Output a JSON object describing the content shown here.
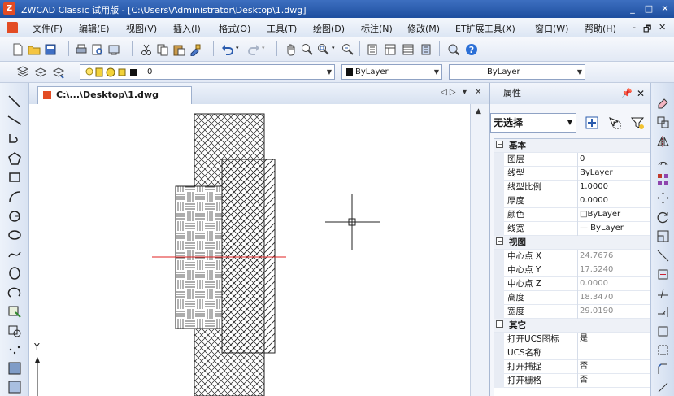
{
  "window": {
    "title": "ZWCAD Classic 试用版 - [C:\\Users\\Administrator\\Desktop\\1.dwg]",
    "controls": [
      "_",
      "□",
      "✕"
    ]
  },
  "menu": {
    "items": [
      "文件(F)",
      "编辑(E)",
      "视图(V)",
      "插入(I)",
      "格式(O)",
      "工具(T)",
      "绘图(D)",
      "标注(N)",
      "修改(M)",
      "ET扩展工具(X)",
      "窗口(W)",
      "帮助(H)"
    ],
    "mdi_controls": [
      "-",
      "🗗",
      "✕"
    ]
  },
  "toolbar": {
    "layer_value": "0",
    "color_value": "ByLayer",
    "linetype_value": "ByLayer"
  },
  "document": {
    "tab_label": "C:\\...\\Desktop\\1.dwg",
    "tab_controls": [
      "◁ ▷",
      "▾",
      "✕"
    ]
  },
  "canvas": {
    "ucs_label": "Y"
  },
  "properties": {
    "title": "属性",
    "pin": "📌",
    "close": "✕",
    "selection": "无选择",
    "categories": [
      {
        "name": "基本",
        "toggle": "⊟",
        "rows": [
          {
            "name": "图层",
            "value": "0",
            "gray": false
          },
          {
            "name": "线型",
            "value": "ByLayer",
            "gray": false
          },
          {
            "name": "线型比例",
            "value": "1.0000",
            "gray": false
          },
          {
            "name": "厚度",
            "value": "0.0000",
            "gray": false
          },
          {
            "name": "颜色",
            "value": "□ByLayer",
            "gray": false
          },
          {
            "name": "线宽",
            "value": "— ByLayer",
            "gray": false
          }
        ]
      },
      {
        "name": "视图",
        "toggle": "⊟",
        "rows": [
          {
            "name": "中心点 X",
            "value": "24.7676",
            "gray": true
          },
          {
            "name": "中心点 Y",
            "value": "17.5240",
            "gray": true
          },
          {
            "name": "中心点 Z",
            "value": "0.0000",
            "gray": true
          },
          {
            "name": "高度",
            "value": "18.3470",
            "gray": true
          },
          {
            "name": "宽度",
            "value": "29.0190",
            "gray": true
          }
        ]
      },
      {
        "name": "其它",
        "toggle": "⊟",
        "rows": [
          {
            "name": "打开UCS图标",
            "value": "是",
            "gray": false
          },
          {
            "name": "UCS名称",
            "value": "",
            "gray": false
          },
          {
            "name": "打开捕捉",
            "value": "否",
            "gray": false
          },
          {
            "name": "打开栅格",
            "value": "否",
            "gray": false
          }
        ]
      }
    ]
  },
  "colors": {
    "titlebar": "#1e4f9f",
    "crosshair": "#222222",
    "centerline": "#e02020",
    "hatch": "#222222"
  }
}
